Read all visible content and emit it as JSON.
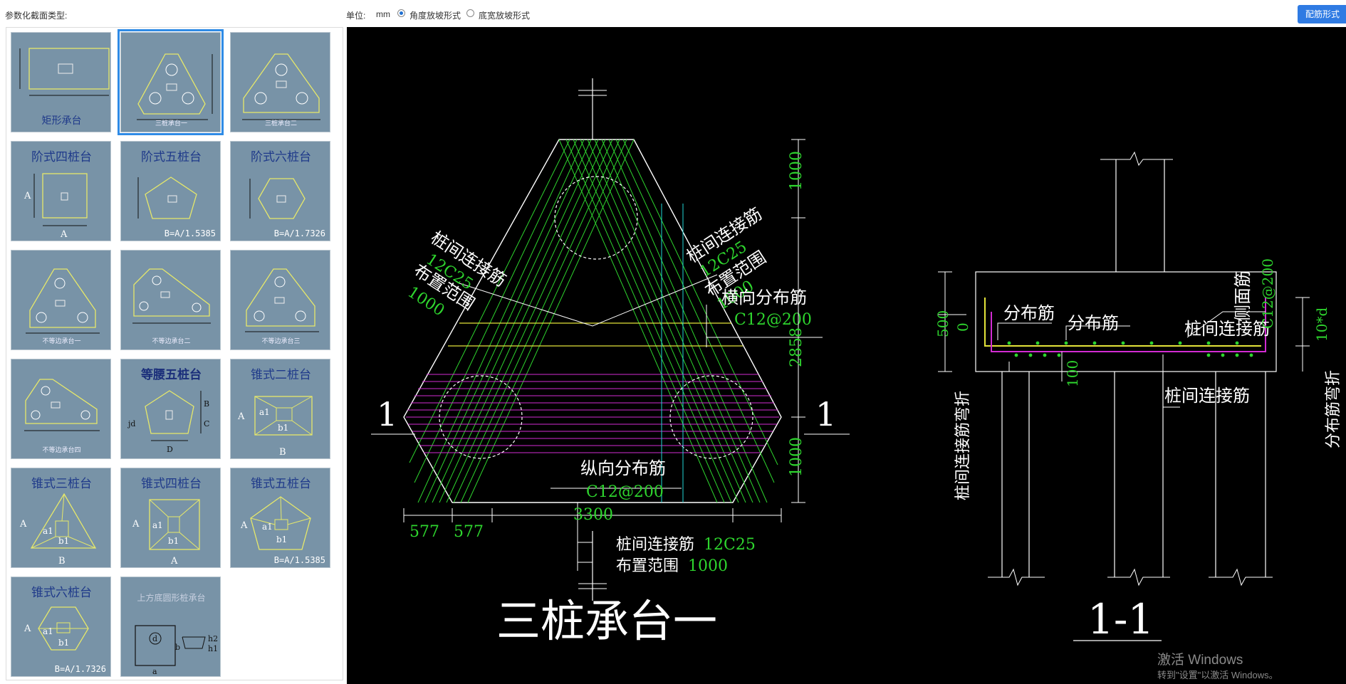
{
  "toolbar": {
    "section_type_label": "参数化截面类型:",
    "unit_label": "单位:",
    "unit_value": "mm",
    "slope_options": [
      {
        "label": "角度放坡形式",
        "selected": true
      },
      {
        "label": "底宽放坡形式",
        "selected": false
      }
    ],
    "rebar_button": "配筋形式"
  },
  "tiles": [
    {
      "name": "矩形承台",
      "sub": "",
      "selected": false
    },
    {
      "name": "三桩承台一",
      "sub": "",
      "selected": true
    },
    {
      "name": "三桩承台二",
      "sub": "",
      "selected": false
    },
    {
      "name": "阶式四桩台",
      "sub": "",
      "selected": false
    },
    {
      "name": "阶式五桩台",
      "sub": "B=A/1.5385",
      "selected": false
    },
    {
      "name": "阶式六桩台",
      "sub": "B=A/1.7326",
      "selected": false
    },
    {
      "name": "不等边承台一",
      "sub": "",
      "selected": false
    },
    {
      "name": "不等边承台二",
      "sub": "",
      "selected": false
    },
    {
      "name": "不等边承台三",
      "sub": "",
      "selected": false
    },
    {
      "name": "不等边承台四",
      "sub": "",
      "selected": false
    },
    {
      "name": "等腰五桩台",
      "sub": "",
      "selected": false
    },
    {
      "name": "锥式二桩台",
      "sub": "",
      "selected": false
    },
    {
      "name": "锥式三桩台",
      "sub": "",
      "selected": false
    },
    {
      "name": "锥式四桩台",
      "sub": "",
      "selected": false
    },
    {
      "name": "锥式五桩台",
      "sub": "B=A/1.5385",
      "selected": false
    },
    {
      "name": "锥式六桩台",
      "sub": "B=A/1.7326",
      "selected": false
    },
    {
      "name": "上方底圆形桩承台",
      "sub": "",
      "selected": false
    }
  ],
  "drawing": {
    "title": "三桩承台一",
    "section_title": "1-1",
    "section_mark": "1",
    "labels": {
      "link_rebar": "桩间连接筋",
      "link_spec": "12C25",
      "layout_range": "布置范围",
      "range_value": "1000",
      "trans_dist": "横向分布筋",
      "dist_spec": "C12@200",
      "long_dist": "纵向分布筋",
      "bottom_link": "桩间连接筋 12C25",
      "bottom_range": "布置范围",
      "bottom_range_value": "1000",
      "dist_bar": "分布筋",
      "side_bar": "侧面筋",
      "side_spec": "C12@200",
      "link_bend": "桩间连接筋弯折",
      "dist_bend": "分布筋弯折",
      "bend_len": "10*d"
    },
    "dims": {
      "top": "1000",
      "mid": "2858",
      "bot": "1000",
      "width": "3300",
      "edge1": "577",
      "edge2": "577",
      "height": "500",
      "zero": "0",
      "cover": "100"
    }
  },
  "watermark": {
    "line1": "激活 Windows",
    "line2": "转到\"设置\"以激活 Windows。"
  }
}
